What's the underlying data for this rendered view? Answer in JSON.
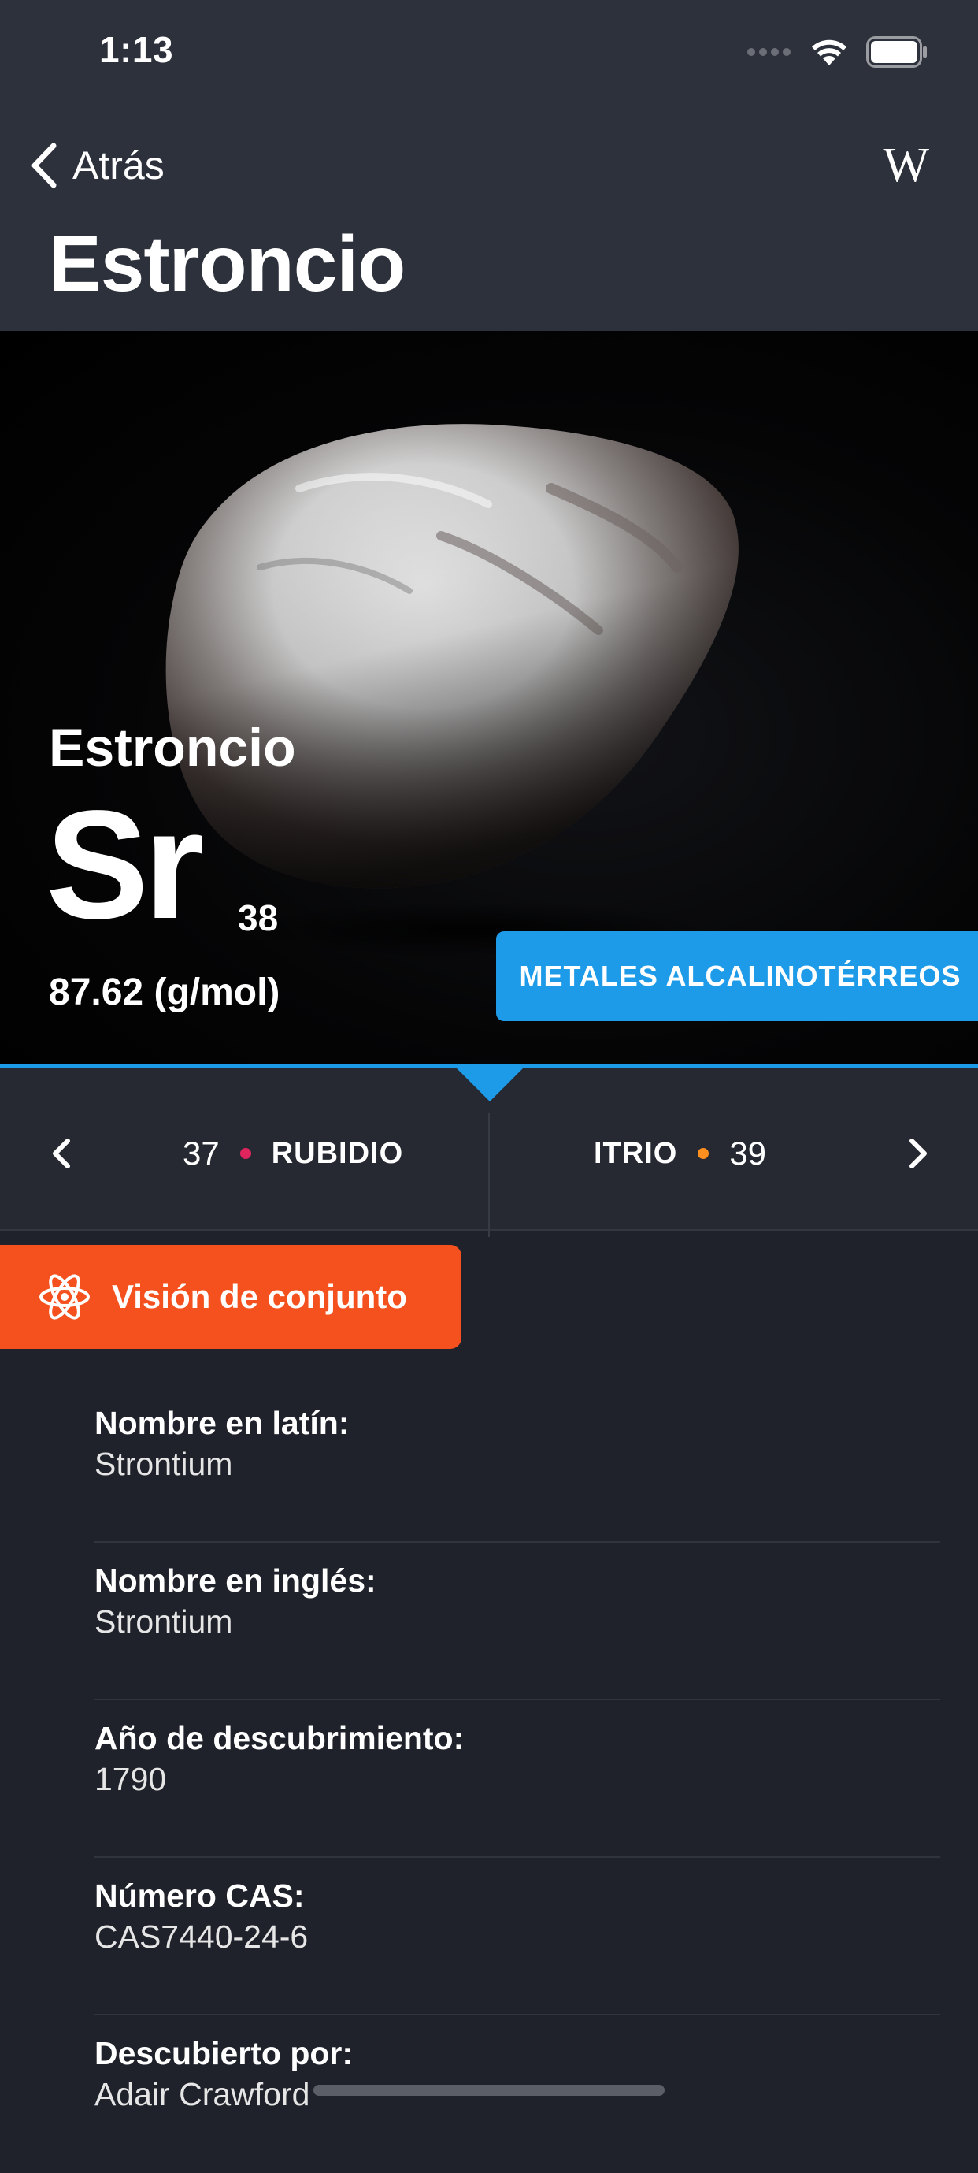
{
  "status_bar": {
    "time": "1:13"
  },
  "nav": {
    "back_label": "Atrás",
    "wiki_label": "W",
    "title": "Estroncio"
  },
  "hero": {
    "name": "Estroncio",
    "symbol": "Sr",
    "atomic_number": "38",
    "atomic_mass": "87.62 (g/mol)",
    "category": "METALES ALCALINOTÉRREOS"
  },
  "neighbors": {
    "previous": {
      "number": "37",
      "name": "RUBIDIO",
      "dot_color": "#e0245e"
    },
    "next": {
      "number": "39",
      "name": "ITRIO",
      "dot_color": "#ff8f1f"
    }
  },
  "tab": {
    "label": "Visión de conjunto",
    "icon": "atom-icon"
  },
  "info": [
    {
      "label": "Nombre en latín:",
      "value": "Strontium"
    },
    {
      "label": "Nombre en inglés:",
      "value": "Strontium"
    },
    {
      "label": "Año de descubrimiento:",
      "value": "1790"
    },
    {
      "label": "Número CAS:",
      "value": "CAS7440-24-6"
    },
    {
      "label": "Descubierto por:",
      "value": "Adair Crawford"
    }
  ],
  "colors": {
    "accent_blue": "#1e9be8",
    "accent_orange": "#f4511e",
    "background": "#1f222a",
    "header": "#2d313b"
  }
}
